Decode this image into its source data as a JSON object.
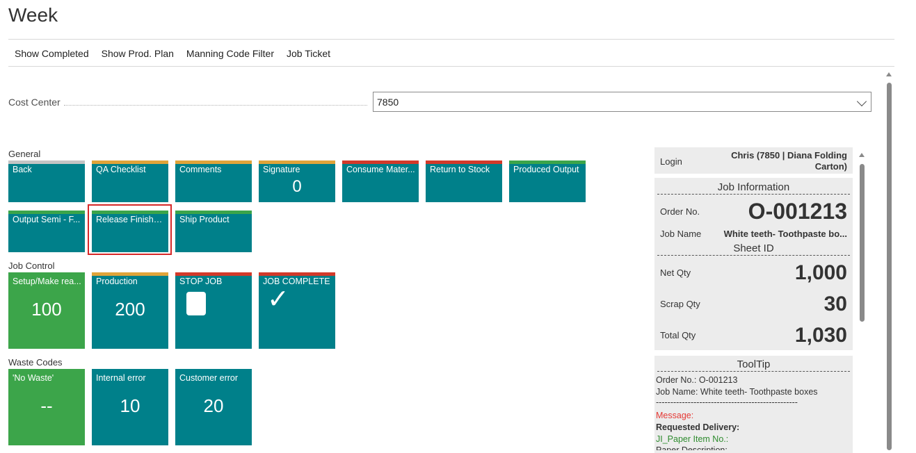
{
  "page": {
    "title": "Week"
  },
  "actions": [
    "Show Completed",
    "Show Prod. Plan",
    "Manning Code Filter",
    "Job Ticket"
  ],
  "cost_center": {
    "label": "Cost Center",
    "value": "7850"
  },
  "groups": {
    "general": "General",
    "job_control": "Job Control",
    "waste_codes": "Waste Codes"
  },
  "tiles": {
    "back": {
      "label": "Back",
      "bar": "#c4c4c4"
    },
    "qa_checklist": {
      "label": "QA Checklist",
      "bar": "#e0a43a"
    },
    "comments": {
      "label": "Comments",
      "bar": "#e0a43a"
    },
    "signature": {
      "label": "Signature",
      "value": "0",
      "bar": "#e0a43a"
    },
    "consume_material": {
      "label": "Consume Mater...",
      "bar": "#d23a2a"
    },
    "return_to_stock": {
      "label": "Return to Stock",
      "bar": "#d23a2a"
    },
    "produced_output": {
      "label": "Produced Output",
      "bar": "#3ca54a"
    },
    "output_semi": {
      "label": "Output Semi - F...",
      "bar": "#3ca54a"
    },
    "release_finished": {
      "label": "Release Finishe...",
      "bar": "#3ca54a"
    },
    "ship_product": {
      "label": "Ship Product",
      "bar": "#3ca54a"
    },
    "setup_make_ready": {
      "label": "Setup/Make rea...",
      "value": "100"
    },
    "production": {
      "label": "Production",
      "value": "200",
      "bar": "#e0a43a"
    },
    "stop_job": {
      "label": "STOP JOB",
      "bar": "#d23a2a",
      "icon": "stop-icon"
    },
    "job_complete": {
      "label": "JOB COMPLETE",
      "bar": "#d23a2a",
      "icon": "check-icon",
      "glyph": "✓"
    },
    "no_waste": {
      "label": "'No Waste'",
      "value": "--"
    },
    "internal_error": {
      "label": "Internal error",
      "value": "10"
    },
    "customer_error": {
      "label": "Customer error",
      "value": "20"
    }
  },
  "factbox": {
    "login_label": "Login",
    "login_value": "Chris (7850 | Diana Folding Carton)",
    "job_info_title": "Job Information",
    "order_no_label": "Order No.",
    "order_no_value": "O-001213",
    "job_name_label": "Job Name",
    "job_name_value": "White teeth- Toothpaste bo...",
    "sheet_id_title": "Sheet ID",
    "net_qty_label": "Net Qty",
    "net_qty_value": "1,000",
    "scrap_qty_label": "Scrap Qty",
    "scrap_qty_value": "30",
    "total_qty_label": "Total Qty",
    "total_qty_value": "1,030"
  },
  "tooltip": {
    "title": "ToolTip",
    "order_line": "Order No.: O-001213",
    "job_line": "Job Name: White teeth- Toothpaste boxes",
    "separator": "-------------------------------------------------",
    "message_label": "Message:",
    "requested_delivery": "Requested Delivery:",
    "paper_item": "JI_Paper Item No.:",
    "paper_description": "Paper Description:"
  },
  "colors": {
    "teal": "#00808a",
    "green": "#3ca54a",
    "message_red": "#e53935",
    "item_green": "#2e8b2e"
  }
}
